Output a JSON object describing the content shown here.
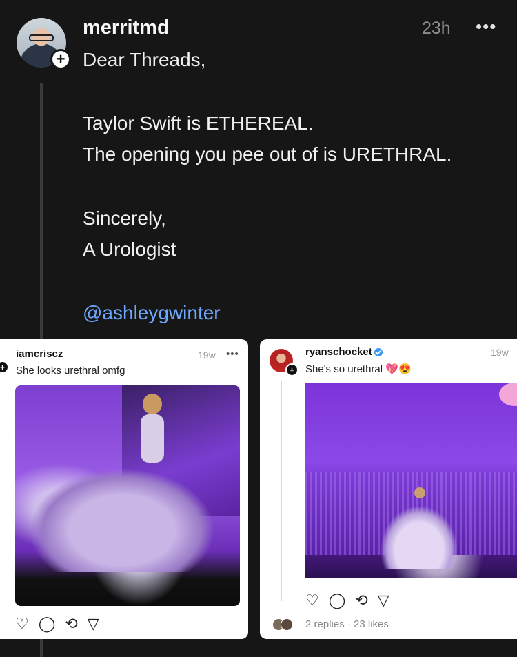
{
  "post": {
    "username": "merritmd",
    "time": "23h",
    "more_icon": "•••",
    "lines": [
      "Dear Threads,",
      "Taylor Swift is ETHEREAL.",
      "The opening you pee out of is URETHRAL.",
      "Sincerely,",
      "A Urologist"
    ],
    "mention": "@ashleygwinter",
    "plus_badge": "+"
  },
  "embed1": {
    "username": "iamcriscz",
    "time": "19w",
    "more_icon": "•••",
    "text": "She looks urethral omfg",
    "plus_badge": "+",
    "actions": [
      "♡",
      "◯",
      "⟲",
      "▽"
    ]
  },
  "embed2": {
    "username": "ryanschocket",
    "time": "19w",
    "text": "She's so urethral",
    "emoji": "💖😍",
    "plus_badge": "+",
    "actions": [
      "♡",
      "◯",
      "⟲",
      "▽"
    ],
    "stats": "2 replies · 23 likes"
  },
  "colors": {
    "background": "#161616",
    "mention": "#6ea8fe",
    "muted": "#8e8e8e"
  }
}
